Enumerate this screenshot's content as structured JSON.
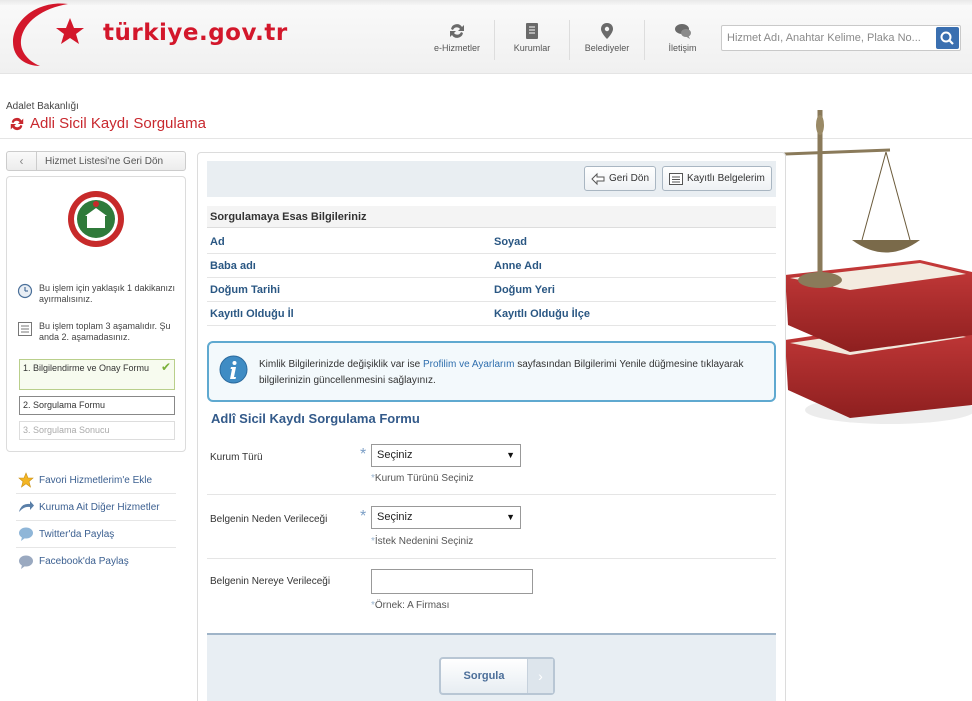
{
  "header": {
    "logo_text": "türkiye.gov.tr",
    "nav": [
      {
        "label": "e-Hizmetler",
        "icon": "refresh-arrows-icon"
      },
      {
        "label": "Kurumlar",
        "icon": "book-icon"
      },
      {
        "label": "Belediyeler",
        "icon": "map-pin-icon"
      },
      {
        "label": "İletişim",
        "icon": "chat-bubbles-icon"
      }
    ],
    "search_placeholder": "Hizmet Adı, Anahtar Kelime, Plaka No..."
  },
  "page": {
    "breadcrumb": "Adalet Bakanlığı",
    "title": "Adli Sicil Kaydı Sorgulama"
  },
  "sidebar": {
    "back_label": "Hizmet Listesi'ne Geri Dön",
    "duration_text": "Bu işlem için yaklaşık 1 dakikanızı ayırmalısınız.",
    "stage_text": "Bu işlem toplam 3 aşamalıdır. Şu anda 2. aşamadasınız.",
    "steps": [
      {
        "label": "1. Bilgilendirme ve Onay Formu",
        "status": "done"
      },
      {
        "label": "2. Sorgulama Formu",
        "status": "current"
      },
      {
        "label": "3. Sorgulama Sonucu",
        "status": "pending"
      }
    ],
    "links": [
      {
        "label": "Favori Hizmetlerim'e Ekle",
        "icon": "star-icon"
      },
      {
        "label": "Kuruma Ait Diğer Hizmetler",
        "icon": "curved-arrow-icon"
      },
      {
        "label": "Twitter'da Paylaş",
        "icon": "twitter-icon"
      },
      {
        "label": "Facebook'da Paylaş",
        "icon": "facebook-icon"
      }
    ]
  },
  "toolbar": {
    "back_label": "Geri Dön",
    "docs_label": "Kayıtlı Belgelerim"
  },
  "info": {
    "header": "Sorgulamaya Esas Bilgileriniz",
    "fields": [
      {
        "left": "Ad",
        "right": "Soyad"
      },
      {
        "left": "Baba adı",
        "right": "Anne Adı"
      },
      {
        "left": "Doğum Tarihi",
        "right": "Doğum Yeri"
      },
      {
        "left": "Kayıtlı Olduğu İl",
        "right": "Kayıtlı Olduğu İlçe"
      }
    ]
  },
  "alert": {
    "text_before": "Kimlik Bilgilerinizde değişiklik var ise ",
    "link": "Profilim ve Ayarlarım",
    "text_after": " sayfasından Bilgilerimi Yenile düğmesine tıklayarak bilgilerinizin güncellenmesini sağlayınız."
  },
  "form": {
    "title": "Adlî Sicil Kaydı Sorgulama Formu",
    "kurum_label": "Kurum Türü",
    "kurum_value": "Seçiniz",
    "kurum_hint": "Kurum Türünü Seçiniz",
    "neden_label": "Belgenin Neden Verileceği",
    "neden_value": "Seçiniz",
    "neden_hint": "İstek Nedenini Seçiniz",
    "nereye_label": "Belgenin Nereye Verileceği",
    "nereye_value": "",
    "nereye_hint": "Örnek: A Firması",
    "required_mark": "*",
    "submit_label": "Sorgula"
  },
  "colors": {
    "brand_red": "#d3172b",
    "link_blue": "#2a5783",
    "alert_border": "#5fa9d0"
  }
}
